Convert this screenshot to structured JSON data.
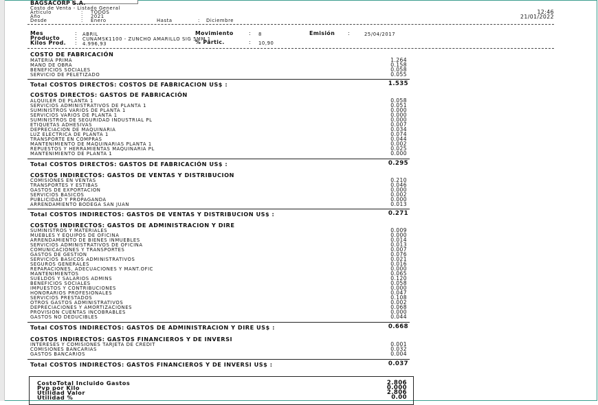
{
  "header": {
    "company": "BAGSACORP S.A.",
    "report_title": "Costo de Venta - Listado General",
    "articulo_label": "Artículo",
    "articulo_sep": ":",
    "articulo_value": "TODOS",
    "anio_label": "Año",
    "anio_sep": ":",
    "anio_value": "2021",
    "desde_label": "Desde",
    "desde_sep": ":",
    "desde_value": "Enero",
    "hasta_label": "Hasta",
    "hasta_sep": ":",
    "hasta_value": "Diciembre",
    "time": "12:46",
    "date": "21/01/2022"
  },
  "info": {
    "mes_label": "Mes",
    "mes_sep": ":",
    "mes_value": "ABRIL",
    "producto_label": "Producto",
    "producto_sep": ":",
    "producto_value": "CUNAMSK1100 - ZUNCHO AMARILLO SIG 5MM 1",
    "kilos_label": "Kilos Prod.",
    "kilos_sep": ":",
    "kilos_value": "4.996,93",
    "movimiento_label": "Movimiento",
    "movimiento_sep": ":",
    "movimiento_value": "8",
    "partic_label": "% Partic.",
    "partic_sep": ":",
    "partic_value": "10,90",
    "emision_label": "Emisión",
    "emision_sep": ":",
    "emision_value": "25/04/2017"
  },
  "sections": [
    {
      "title": "COSTO DE FABRICACIÓN",
      "items": [
        {
          "label": "MATERIA PRIMA",
          "value": "1.264"
        },
        {
          "label": "MANO DE OBRA",
          "value": "0.158"
        },
        {
          "label": "BENEFICIOS SOCIALES",
          "value": "0.058"
        },
        {
          "label": "SERVICIO DE PELETIZADO",
          "value": "0.055"
        }
      ],
      "total_label": "Total COSTOS DIRECTOS: COSTOS DE FABRICACION US$ :",
      "total_value": "1.535"
    },
    {
      "title": "COSTOS DIRECTOS: GASTOS DE FABRICACIÓN",
      "items": [
        {
          "label": "ALQUILER DE PLANTA 1",
          "value": "0.058"
        },
        {
          "label": "SERVICIOS ADMINISTRATIVOS DE PLANTA 1",
          "value": "0.051"
        },
        {
          "label": "SUMINISTROS VARIOS DE PLANTA 1",
          "value": "0.000"
        },
        {
          "label": "SERVICIOS VARIOS DE PLANTA 1",
          "value": "0.000"
        },
        {
          "label": "SUMINISTROS DE SEGURIDAD INDUSTRIAL PL",
          "value": "0.000"
        },
        {
          "label": "ETIQUETAS ADHESIVAS",
          "value": "0.007"
        },
        {
          "label": "DEPRECIACION DE MAQUINARIA",
          "value": "0.034"
        },
        {
          "label": "LUZ ELECTRICA DE PLANTA 1",
          "value": "0.074"
        },
        {
          "label": "TRANSPORTE EN COMPRAS",
          "value": "0.044"
        },
        {
          "label": "MANTENIMIENTO DE MAQUINARIAS PLANTA 1",
          "value": "0.002"
        },
        {
          "label": "REPUESTOS Y HERRAMIENTAS MAQUINARIA PL",
          "value": "0.025"
        },
        {
          "label": "MANTENIMIENTO DE PLANTA 1",
          "value": "0.000"
        }
      ],
      "total_label": "Total COSTOS DIRECTOS: GASTOS DE FABRICACIÓN US$ :",
      "total_value": "0.295"
    },
    {
      "title": "COSTOS INDIRECTOS: GASTOS DE VENTAS Y DISTRIBUCION",
      "items": [
        {
          "label": "COMISIONES EN VENTAS",
          "value": "0.210"
        },
        {
          "label": "TRANSPORTES Y ESTIBAS",
          "value": "0.046"
        },
        {
          "label": "GASTOS DE EXPORTACION",
          "value": "0.000"
        },
        {
          "label": "SERVICIOS BASICOS",
          "value": "0.002"
        },
        {
          "label": "PUBLICIDAD Y PROPAGANDA",
          "value": "0.000"
        },
        {
          "label": "ARRENDAMIENTO BODEGA SAN JUAN",
          "value": "0.013"
        }
      ],
      "total_label": "Total COSTOS INDIRECTOS: GASTOS DE VENTAS Y DISTRIBUCION US$ :",
      "total_value": "0.271"
    },
    {
      "title": "COSTOS INDIRECTOS: GASTOS DE ADMINISTRACION Y DIRE",
      "items": [
        {
          "label": "SUMINISTROS Y MATERIALES",
          "value": "0.009"
        },
        {
          "label": "MUEBLES Y EQUIPOS DE OFICINA",
          "value": "0.000"
        },
        {
          "label": "ARRENDAMIENTO DE BIENES INMUEBLES",
          "value": "0.014"
        },
        {
          "label": "SERVICIOS ADMINISTRATIVOS DE OFICINA",
          "value": "0.013"
        },
        {
          "label": "COMUNICACIONES Y TRANSPORTES",
          "value": "0.007"
        },
        {
          "label": "GASTOS DE GESTION",
          "value": "0.076"
        },
        {
          "label": "SERVICIOS BASICOS ADMINISTRATIVOS",
          "value": "0.021"
        },
        {
          "label": "SEGUROS GENERALES",
          "value": "0.016"
        },
        {
          "label": "REPARACIONES, ADECUACIONES Y MANT.OFIC",
          "value": "0.000"
        },
        {
          "label": "MANTENIMIENTOS",
          "value": "0.065"
        },
        {
          "label": "SUELDOS Y SALARIOS ADMINS",
          "value": "0.120"
        },
        {
          "label": "BENEFICIOS SOCIALES",
          "value": "0.058"
        },
        {
          "label": "IMPUESTOS Y CONTRIBUCIONES",
          "value": "0.000"
        },
        {
          "label": "HONORARIOS PROFESIONALES",
          "value": "0.047"
        },
        {
          "label": "SERVICIOS PRESTADOS",
          "value": "0.108"
        },
        {
          "label": "OTROS GASTOS ADMINISTRATIVOS",
          "value": "0.002"
        },
        {
          "label": "DEPRECIACIONES Y AMORTIZACIONES",
          "value": "0.068"
        },
        {
          "label": "PROVISION CUENTAS INCOBRABLES",
          "value": "0.000"
        },
        {
          "label": "GASTOS NO DEDUCIBLES",
          "value": "0.044"
        }
      ],
      "total_label": "Total COSTOS INDIRECTOS: GASTOS DE ADMINISTRACION Y DIRE US$ :",
      "total_value": "0.668"
    },
    {
      "title": "COSTOS INDIRECTOS: GASTOS FINANCIEROS Y DE INVERSI",
      "items": [
        {
          "label": "INTERESES Y COMISIONES TARJETA DE CREDIT",
          "value": "0.001"
        },
        {
          "label": "COMISIONES BANCARIAS",
          "value": "0.032"
        },
        {
          "label": "GASTOS BANCARIOS",
          "value": "0.004"
        }
      ],
      "total_label": "Total COSTOS INDIRECTOS: GASTOS FINANCIEROS Y DE INVERSI US$ :",
      "total_value": "0.037"
    }
  ],
  "summary": [
    {
      "label": "CostoTotal Incluido Gastos",
      "value": "2.806"
    },
    {
      "label": "Pvp por Kilo",
      "value": "0.000"
    },
    {
      "label": "Utilidad Valor",
      "value": "2.806"
    },
    {
      "label": "Utilidad %",
      "value": "0.00"
    }
  ]
}
